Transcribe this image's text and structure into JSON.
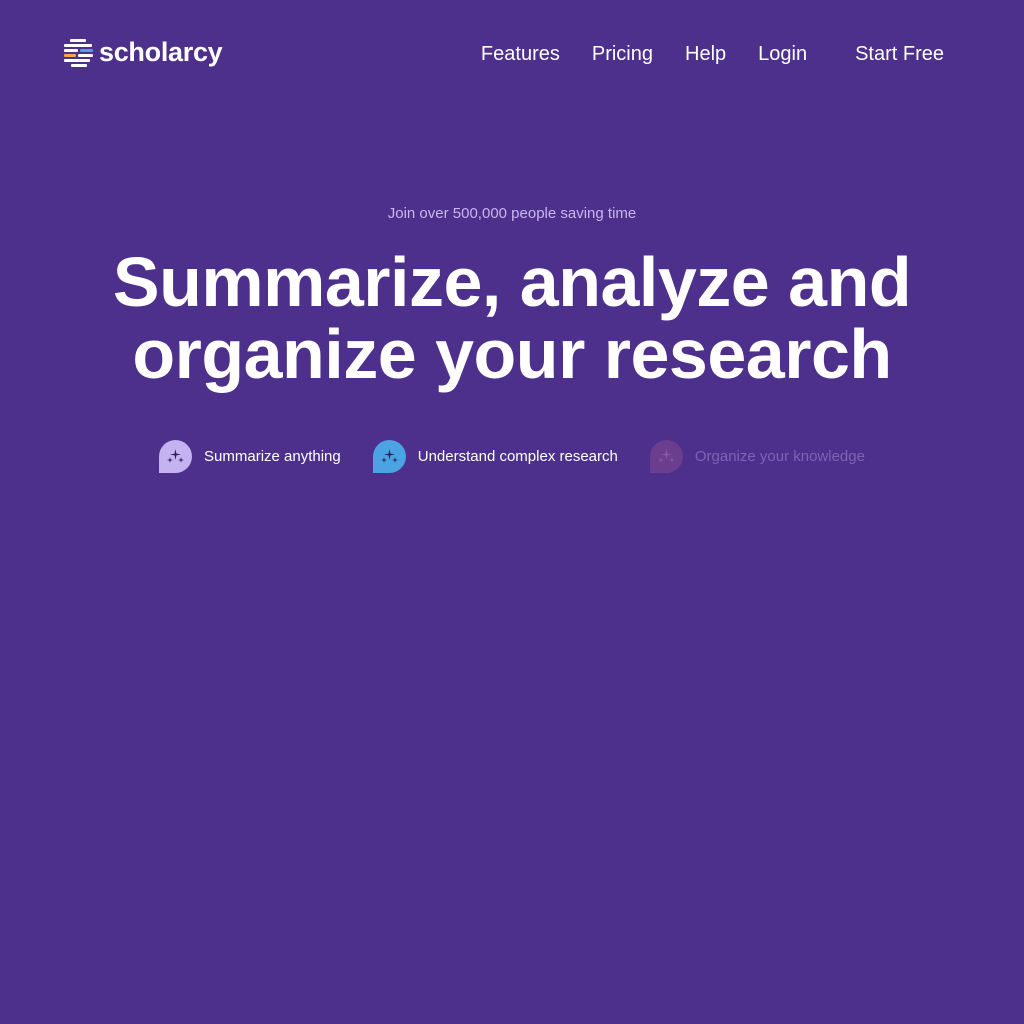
{
  "brand": {
    "name": "scholarcy",
    "logo_icon": "stacked-bars-logo",
    "colors": {
      "background": "#4d2f8c",
      "eyebrow_text": "#c9b6ef",
      "faded_text": "#7c64b4",
      "icon_purple": "#c4b3f0",
      "icon_blue": "#4ba3e3",
      "icon_faded": "#6b3d8f"
    }
  },
  "nav": {
    "links": [
      {
        "label": "Features"
      },
      {
        "label": "Pricing"
      },
      {
        "label": "Help"
      },
      {
        "label": "Login"
      }
    ],
    "cta": "Start Free"
  },
  "hero": {
    "eyebrow": "Join over 500,000 people saving time",
    "headline_line1": "Summarize, analyze and",
    "headline_line2": "organize your research"
  },
  "features": [
    {
      "label": "Summarize anything",
      "icon": "sparkle-chat-icon",
      "state": "active"
    },
    {
      "label": "Understand complex research",
      "icon": "sparkle-chat-icon",
      "state": "active"
    },
    {
      "label": "Organize your knowledge",
      "icon": "sparkle-chat-icon",
      "state": "faded"
    }
  ]
}
